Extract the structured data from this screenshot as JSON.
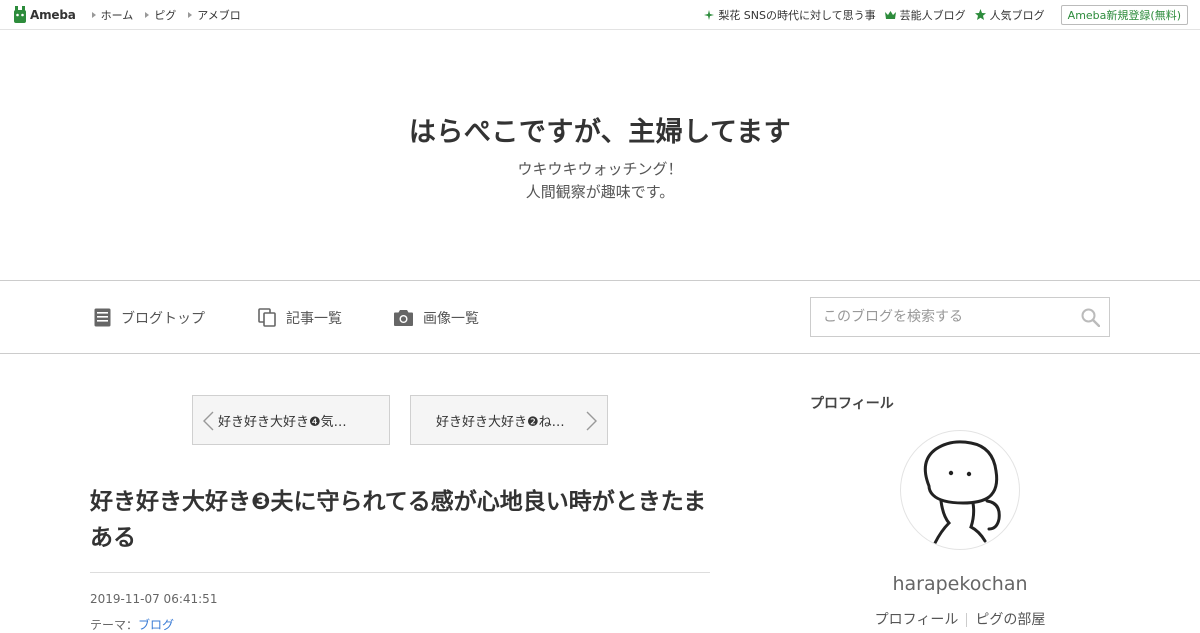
{
  "global_nav": {
    "logo_text": "Ameba",
    "items": [
      {
        "label": "ホーム"
      },
      {
        "label": "ピグ"
      },
      {
        "label": "アメブロ"
      }
    ],
    "right_items": [
      {
        "label": "梨花 SNSの時代に対して思う事",
        "icon": "sparkle-icon"
      },
      {
        "label": "芸能人ブログ",
        "icon": "crown-icon"
      },
      {
        "label": "人気ブログ",
        "icon": "star-icon"
      }
    ],
    "signup_label": "Ameba新規登録(無料)"
  },
  "blog": {
    "title": "はらぺこですが、主婦してます",
    "description_line1": "ウキウキウォッチング！",
    "description_line2": "人間観察が趣味です。"
  },
  "blog_nav": {
    "items": [
      {
        "label": "ブログトップ",
        "icon": "document-icon"
      },
      {
        "label": "記事一覧",
        "icon": "copy-icon"
      },
      {
        "label": "画像一覧",
        "icon": "camera-icon"
      }
    ],
    "search_placeholder": "このブログを検索する"
  },
  "pager": {
    "prev_label": "好き好き大好き❹気…",
    "next_label": "好き好き大好き❷ね…"
  },
  "article": {
    "title": "好き好き大好き❸夫に守られてる感が心地良い時がときたまある",
    "date": "2019-11-07 06:41:51",
    "theme_label": "テーマ：",
    "theme_value": "ブログ"
  },
  "sidebar": {
    "heading": "プロフィール",
    "profile_name": "harapekochan",
    "links": [
      {
        "label": "プロフィール"
      },
      {
        "label": "ピグの部屋"
      }
    ]
  },
  "colors": {
    "accent": "#2d8c3c",
    "link": "#3a7bd5"
  }
}
